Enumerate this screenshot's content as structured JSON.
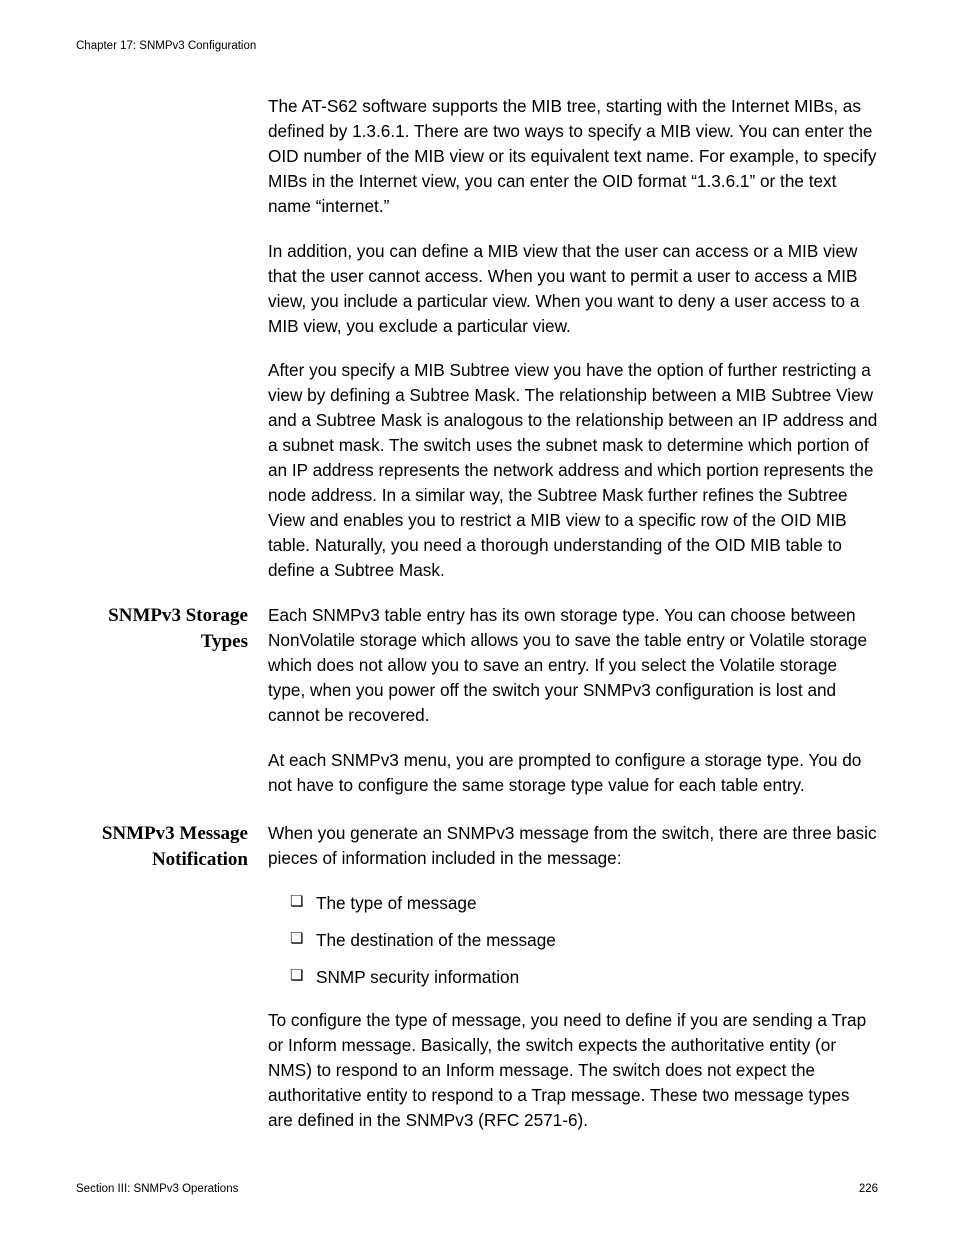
{
  "header": {
    "chapter": "Chapter 17: SNMPv3 Configuration"
  },
  "intro": {
    "p1": "The AT-S62 software supports the MIB tree, starting with the Internet MIBs, as defined by 1.3.6.1. There are two ways to specify a MIB view. You can enter the OID number of the MIB view or its equivalent text name. For example, to specify MIBs in the Internet view, you can enter the OID format “1.3.6.1” or the text name “internet.”",
    "p2": "In addition, you can define a MIB view that the user can access or a MIB view that the user cannot access. When you want to permit a user to access a MIB view, you include a particular view. When you want to deny a user access to a MIB view, you exclude a particular view.",
    "p3": "After you specify a MIB Subtree view you have the option of further restricting a view by defining a Subtree Mask. The relationship between a MIB Subtree View and a Subtree Mask is analogous to the relationship between an IP address and a subnet mask. The switch uses the subnet mask to determine which portion of an IP address represents the network address and which portion represents the node address. In a similar way, the Subtree Mask further refines the Subtree View and enables you to restrict a MIB view to a specific row of the OID MIB table. Naturally, you need a thorough understanding of the OID MIB table to define a Subtree Mask."
  },
  "storage": {
    "heading": "SNMPv3 Storage Types",
    "p1": "Each SNMPv3 table entry has its own storage type. You can choose between NonVolatile storage which allows you to save the table entry or Volatile storage which does not allow you to save an entry. If you select the Volatile storage type, when you power off the switch your SNMPv3 configuration is lost and cannot be recovered.",
    "p2": "At each SNMPv3 menu, you are prompted to configure a storage type. You do not have to configure the same storage type value for each table entry."
  },
  "notification": {
    "heading": "SNMPv3 Message Notification",
    "p1": "When you generate an SNMPv3 message from the switch, there are three basic pieces of information included in the message:",
    "bullets": {
      "b1": "The type of message",
      "b2": "The destination of the message",
      "b3": "SNMP security information"
    },
    "p2": "To configure the type of message, you need to define if you are sending a Trap or Inform message. Basically, the switch expects the authoritative entity (or NMS) to respond to an Inform message. The switch does not expect the authoritative entity to respond to a Trap message. These two message types are defined in the SNMPv3 (RFC 2571-6)."
  },
  "footer": {
    "section": "Section III: SNMPv3 Operations",
    "page": "226"
  }
}
